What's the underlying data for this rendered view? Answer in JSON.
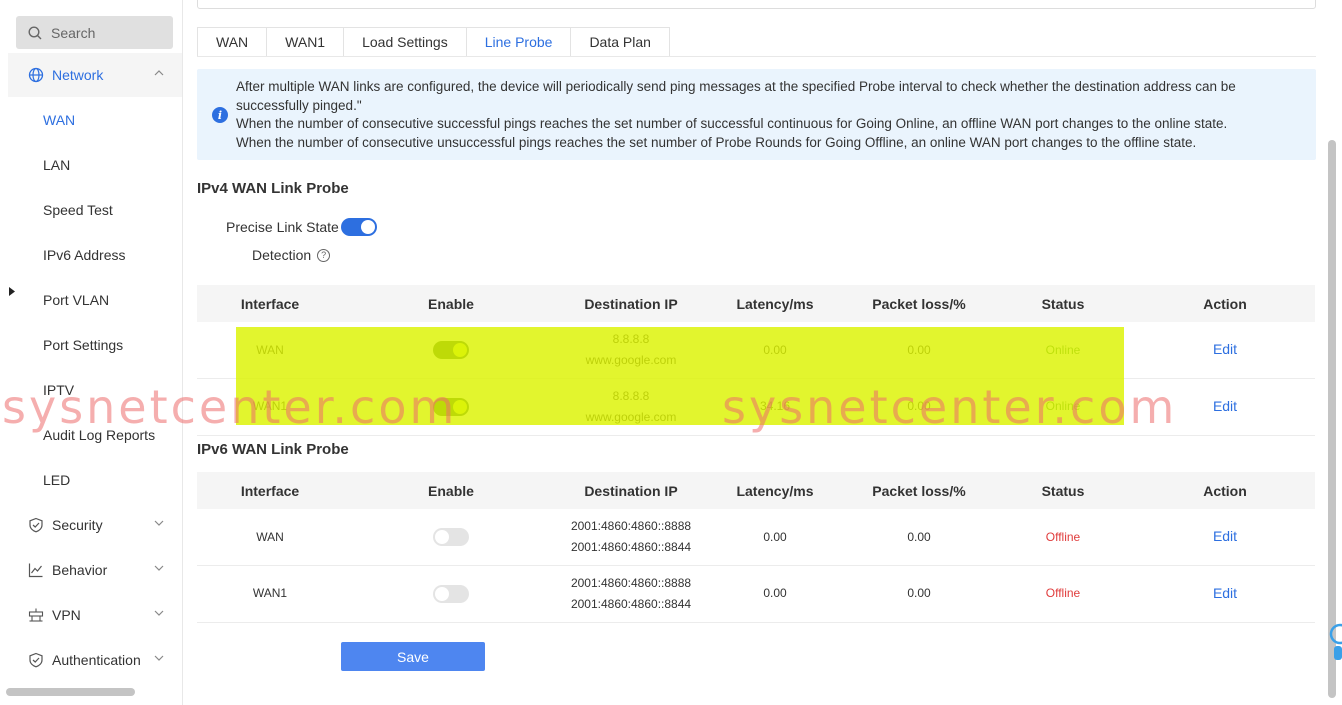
{
  "sidebar": {
    "search_placeholder": "Search",
    "network_label": "Network",
    "network_items": [
      "WAN",
      "LAN",
      "Speed Test",
      "IPv6 Address",
      "Port VLAN",
      "Port Settings",
      "IPTV",
      "Audit Log Reports",
      "LED"
    ],
    "security_label": "Security",
    "behavior_label": "Behavior",
    "vpn_label": "VPN",
    "authentication_label": "Authentication"
  },
  "tabs": [
    "WAN",
    "WAN1",
    "Load Settings",
    "Line Probe",
    "Data Plan"
  ],
  "info": {
    "line1": "After multiple WAN links are configured, the device will periodically send ping messages at the specified Probe interval to check whether the destination address can be",
    "line2": "successfully pinged.\"",
    "line3": "When the number of consecutive successful pings reaches the set number of successful continuous for Going Online, an offline WAN port changes to the online state.",
    "line4": "When the number of consecutive unsuccessful pings reaches the set number of Probe Rounds for Going Offline, an online WAN port changes to the offline state."
  },
  "ipv4": {
    "title": "IPv4 WAN Link Probe",
    "precise_label": "Precise Link State",
    "detection_label": "Detection",
    "precise_enabled": true,
    "headers": [
      "Interface",
      "Enable",
      "Destination IP",
      "Latency/ms",
      "Packet loss/%",
      "Status",
      "Action"
    ],
    "rows": [
      {
        "interface": "WAN",
        "enabled": true,
        "ip1": "8.8.8.8",
        "ip2": "www.google.com",
        "latency": "0.00",
        "loss": "0.00",
        "status": "Online",
        "action": "Edit"
      },
      {
        "interface": "WAN1",
        "enabled": true,
        "ip1": "8.8.8.8",
        "ip2": "www.google.com",
        "latency": "34.16",
        "loss": "0.00",
        "status": "Online",
        "action": "Edit"
      }
    ]
  },
  "ipv6": {
    "title": "IPv6 WAN Link Probe",
    "headers": [
      "Interface",
      "Enable",
      "Destination IP",
      "Latency/ms",
      "Packet loss/%",
      "Status",
      "Action"
    ],
    "rows": [
      {
        "interface": "WAN",
        "enabled": false,
        "ip1": "2001:4860:4860::8888",
        "ip2": "2001:4860:4860::8844",
        "latency": "0.00",
        "loss": "0.00",
        "status": "Offline",
        "action": "Edit"
      },
      {
        "interface": "WAN1",
        "enabled": false,
        "ip1": "2001:4860:4860::8888",
        "ip2": "2001:4860:4860::8844",
        "latency": "0.00",
        "loss": "0.00",
        "status": "Offline",
        "action": "Edit"
      }
    ]
  },
  "save_label": "Save",
  "watermark_text": "sysnetcenter.com",
  "colors": {
    "accent": "#2d6fe0",
    "online": "#3d8a3d",
    "offline": "#e03c3c",
    "highlight": "#dcf300"
  }
}
